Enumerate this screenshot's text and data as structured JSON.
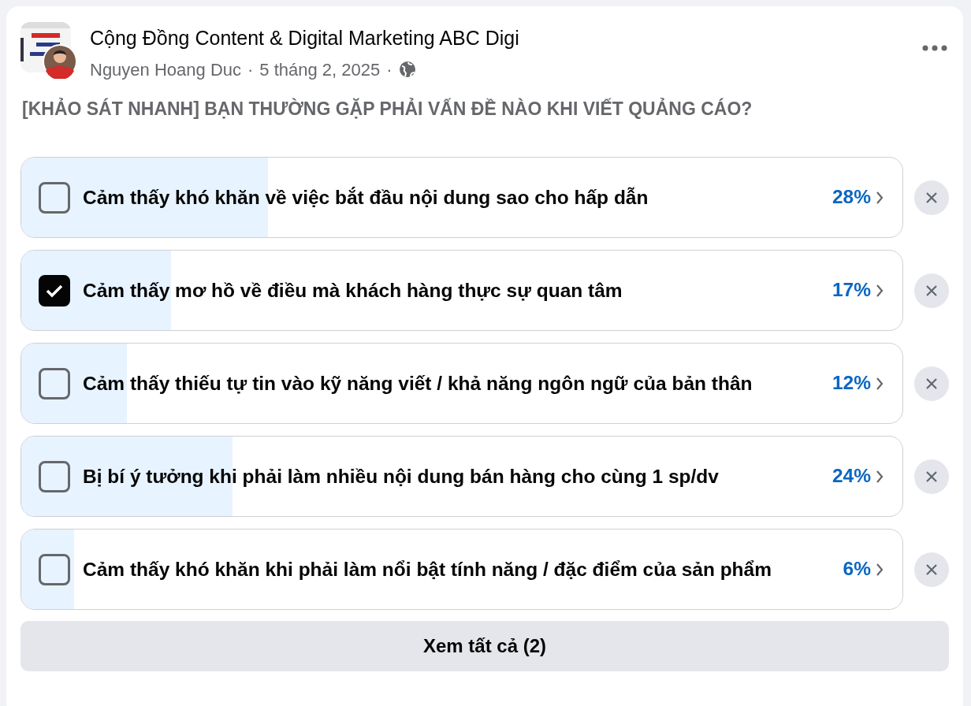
{
  "post": {
    "group": "Cộng Đồng Content & Digital Marketing ABC Digi",
    "author": "Nguyen Hoang Duc",
    "separator_1": "·",
    "date": "5 tháng 2, 2025",
    "separator_2": "·",
    "question": "[KHẢO SÁT NHANH] BẠN THƯỜNG GẶP PHẢI VẤN ĐỀ NÀO KHI VIẾT QUẢNG CÁO?"
  },
  "options": [
    {
      "text": "Cảm thấy khó khăn về việc bắt đầu nội dung sao cho hấp dẫn",
      "percent": "28%",
      "level": 0.28,
      "checked": false
    },
    {
      "text": "Cảm thấy mơ hồ về điều mà khách hàng thực sự quan tâm",
      "percent": "17%",
      "level": 0.17,
      "checked": true
    },
    {
      "text": "Cảm thấy thiếu tự tin vào kỹ năng viết / khả năng ngôn ngữ của bản thân",
      "percent": "12%",
      "level": 0.12,
      "checked": false
    },
    {
      "text": "Bị bí ý tưởng khi phải làm nhiều nội dung bán hàng cho cùng 1 sp/dv",
      "percent": "24%",
      "level": 0.24,
      "checked": false
    },
    {
      "text": "Cảm thấy khó khăn khi phải làm nổi bật tính năng / đặc điểm của sản phẩm",
      "percent": "6%",
      "level": 0.06,
      "checked": false
    }
  ],
  "see_all_button": "Xem tất cả (2)"
}
